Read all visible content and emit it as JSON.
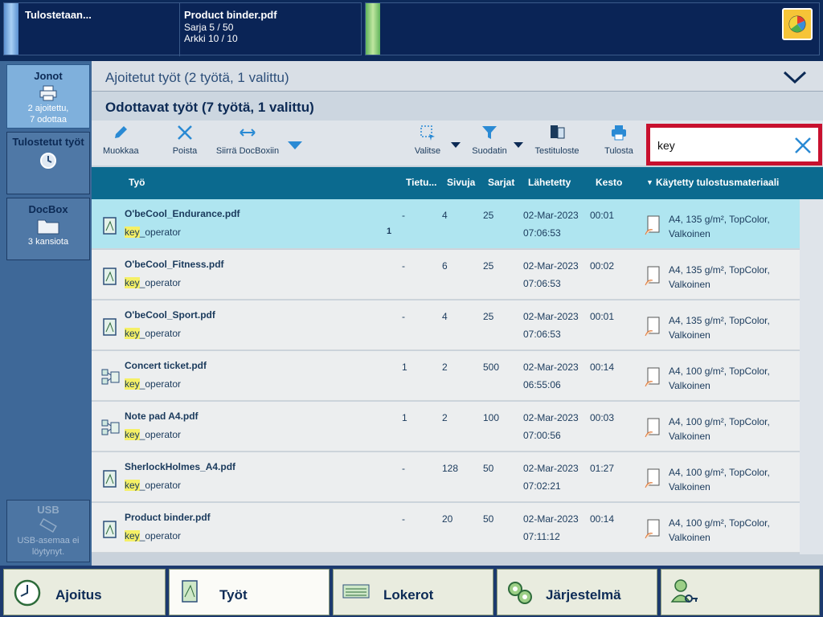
{
  "status": {
    "printing_label": "Tulostetaan...",
    "job_name": "Product binder.pdf",
    "set_progress": "Sarja 5 / 50",
    "sheet_progress": "Arkki 10 / 10"
  },
  "nav": {
    "queues": {
      "title": "Jonot",
      "line1": "2 ajoitettu,",
      "line2": "7 odottaa"
    },
    "printed": {
      "title": "Tulostetut työt"
    },
    "docbox": {
      "title": "DocBox",
      "sub": "3 kansiota"
    },
    "usb": {
      "title": "USB",
      "line1": "USB-asemaa ei",
      "line2": "löytynyt."
    }
  },
  "main": {
    "scheduled_header": "Ajoitetut työt (2 työtä, 1 valittu)",
    "waiting_header": "Odottavat työt (7 työtä, 1 valittu)"
  },
  "toolbar": {
    "edit": "Muokkaa",
    "delete": "Poista",
    "move": "Siirrä DocBoxiin",
    "select": "Valitse",
    "filter": "Suodatin",
    "proof": "Testituloste",
    "print": "Tulosta",
    "search_value": "key"
  },
  "columns": {
    "job": "Työ",
    "info": "Tietu...",
    "pages": "Sivuja",
    "sets": "Sarjat",
    "sent": "Lähetetty",
    "duration": "Kesto",
    "media": "Käytetty tulostusmateriaali"
  },
  "jobs": [
    {
      "name": "O'beCool_Endurance.pdf",
      "user_hl": "key",
      "user_rest": "_operator",
      "info": "-",
      "badge": "1",
      "pages": "4",
      "sets": "25",
      "date": "02-Mar-2023",
      "time": "07:06:53",
      "duration": "00:01",
      "media1": "A4, 135 g/m², TopColor,",
      "media2": "Valkoinen",
      "icon": "document-icon"
    },
    {
      "name": "O'beCool_Fitness.pdf",
      "user_hl": "key",
      "user_rest": "_operator",
      "info": "-",
      "badge": "",
      "pages": "6",
      "sets": "25",
      "date": "02-Mar-2023",
      "time": "07:06:53",
      "duration": "00:02",
      "media1": "A4, 135 g/m², TopColor,",
      "media2": "Valkoinen",
      "icon": "document-icon"
    },
    {
      "name": "O'beCool_Sport.pdf",
      "user_hl": "key",
      "user_rest": "_operator",
      "info": "-",
      "badge": "",
      "pages": "4",
      "sets": "25",
      "date": "02-Mar-2023",
      "time": "07:06:53",
      "duration": "00:01",
      "media1": "A4, 135 g/m², TopColor,",
      "media2": "Valkoinen",
      "icon": "document-icon"
    },
    {
      "name": "Concert ticket.pdf",
      "user_hl": "key",
      "user_rest": "_operator",
      "info": "1",
      "badge": "",
      "pages": "2",
      "sets": "500",
      "date": "02-Mar-2023",
      "time": "06:55:06",
      "duration": "00:14",
      "media1": "A4, 100 g/m², TopColor,",
      "media2": "Valkoinen",
      "icon": "variable-data-icon"
    },
    {
      "name": "Note pad A4.pdf",
      "user_hl": "key",
      "user_rest": "_operator",
      "info": "1",
      "badge": "",
      "pages": "2",
      "sets": "100",
      "date": "02-Mar-2023",
      "time": "07:00:56",
      "duration": "00:03",
      "media1": "A4, 100 g/m², TopColor,",
      "media2": "Valkoinen",
      "icon": "variable-data-icon"
    },
    {
      "name": "SherlockHolmes_A4.pdf",
      "user_hl": "key",
      "user_rest": "_operator",
      "info": "-",
      "badge": "",
      "pages": "128",
      "sets": "50",
      "date": "02-Mar-2023",
      "time": "07:02:21",
      "duration": "01:27",
      "media1": "A4, 100 g/m², TopColor,",
      "media2": "Valkoinen",
      "icon": "document-icon"
    },
    {
      "name": "Product binder.pdf",
      "user_hl": "key",
      "user_rest": "_operator",
      "info": "-",
      "badge": "",
      "pages": "20",
      "sets": "50",
      "date": "02-Mar-2023",
      "time": "07:11:12",
      "duration": "00:14",
      "media1": "A4, 100 g/m², TopColor,",
      "media2": "Valkoinen",
      "icon": "document-icon"
    }
  ],
  "bottom": {
    "schedule": "Ajoitus",
    "jobs": "Työt",
    "trays": "Lokerot",
    "system": "Järjestelmä"
  },
  "colors": {
    "selected_row": "#afe5f0",
    "header": "#0b6a8f",
    "highlight": "#f5f066",
    "search_border": "#c8102e"
  }
}
